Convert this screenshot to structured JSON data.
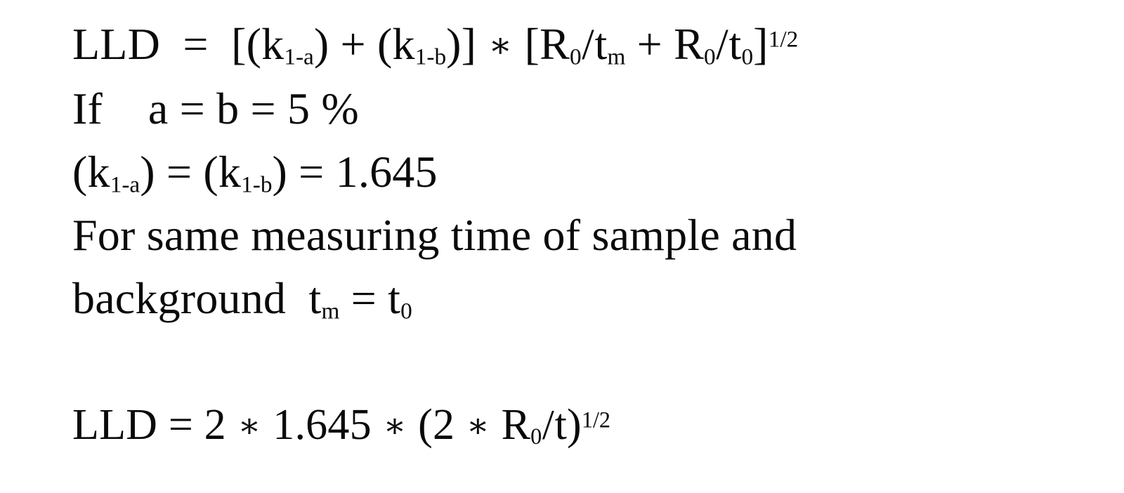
{
  "slide": {
    "background_color": "#ffffff",
    "text_color": "#0a0a0a",
    "lines": [
      {
        "id": "lld-definition",
        "plain_text": "LLD  =  [(k1-a) + (k1-b)] * [R0/tm + R0/t0]1/2",
        "segments": [
          {
            "t": "LLD  =  [(k",
            "k": "text"
          },
          {
            "t": "1-a",
            "k": "sub"
          },
          {
            "t": ") + (k",
            "k": "text"
          },
          {
            "t": "1-b",
            "k": "sub"
          },
          {
            "t": ")] ",
            "k": "text"
          },
          {
            "t": "∗",
            "k": "ast"
          },
          {
            "t": " [R",
            "k": "text"
          },
          {
            "t": "0",
            "k": "sub"
          },
          {
            "t": "/",
            "k": "slash"
          },
          {
            "t": "t",
            "k": "text"
          },
          {
            "t": "m",
            "k": "sub"
          },
          {
            "t": " + R",
            "k": "text"
          },
          {
            "t": "0",
            "k": "sub"
          },
          {
            "t": "/",
            "k": "slash"
          },
          {
            "t": "t",
            "k": "text"
          },
          {
            "t": "0",
            "k": "sub"
          },
          {
            "t": "]",
            "k": "text"
          },
          {
            "t": "1/2",
            "k": "sup"
          }
        ]
      },
      {
        "id": "assumption-alpha-beta",
        "plain_text": "If   a = b = 5 %",
        "segments": [
          {
            "t": "If    a = b = 5 %",
            "k": "text"
          }
        ]
      },
      {
        "id": "k-value",
        "plain_text": "(k1-a) = (k1-b) = 1.645",
        "segments": [
          {
            "t": "(k",
            "k": "text"
          },
          {
            "t": "1-a",
            "k": "sub"
          },
          {
            "t": ") = (k",
            "k": "text"
          },
          {
            "t": "1-b",
            "k": "sub"
          },
          {
            "t": ") = 1.645",
            "k": "text"
          }
        ]
      },
      {
        "id": "same-time-statement-part1",
        "plain_text": "For same measuring time of sample and",
        "segments": [
          {
            "t": "For same measuring time of sample and",
            "k": "text"
          }
        ]
      },
      {
        "id": "same-time-statement-part2",
        "plain_text": "background  tm = t0",
        "segments": [
          {
            "t": "background  t",
            "k": "text"
          },
          {
            "t": "m",
            "k": "sub"
          },
          {
            "t": " = t",
            "k": "text"
          },
          {
            "t": "0",
            "k": "sub"
          }
        ]
      },
      {
        "id": "spacer-blank-line",
        "plain_text": "",
        "segments": []
      },
      {
        "id": "lld-simplified",
        "plain_text": "LLD = 2 * 1.645 * (2 * R0/t)1/2",
        "segments": [
          {
            "t": "LLD = 2 ",
            "k": "text"
          },
          {
            "t": "∗",
            "k": "ast"
          },
          {
            "t": " 1.645 ",
            "k": "text"
          },
          {
            "t": "∗",
            "k": "ast"
          },
          {
            "t": " (2 ",
            "k": "text"
          },
          {
            "t": "∗",
            "k": "ast"
          },
          {
            "t": " R",
            "k": "text"
          },
          {
            "t": "0",
            "k": "sub"
          },
          {
            "t": "/",
            "k": "slash"
          },
          {
            "t": "t)",
            "k": "text"
          },
          {
            "t": "1/2",
            "k": "sup"
          }
        ]
      }
    ]
  }
}
